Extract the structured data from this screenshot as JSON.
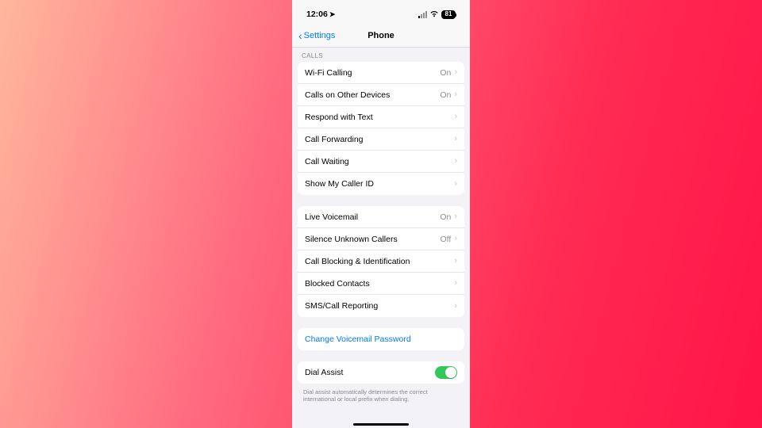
{
  "status": {
    "time": "12:06",
    "battery": "81"
  },
  "nav": {
    "back": "Settings",
    "title": "Phone"
  },
  "sections": {
    "calls_header": "CALLS"
  },
  "calls": [
    {
      "label": "Wi-Fi Calling",
      "value": "On"
    },
    {
      "label": "Calls on Other Devices",
      "value": "On"
    },
    {
      "label": "Respond with Text",
      "value": ""
    },
    {
      "label": "Call Forwarding",
      "value": ""
    },
    {
      "label": "Call Waiting",
      "value": ""
    },
    {
      "label": "Show My Caller ID",
      "value": ""
    }
  ],
  "group2": [
    {
      "label": "Live Voicemail",
      "value": "On"
    },
    {
      "label": "Silence Unknown Callers",
      "value": "Off"
    },
    {
      "label": "Call Blocking & Identification",
      "value": ""
    },
    {
      "label": "Blocked Contacts",
      "value": ""
    },
    {
      "label": "SMS/Call Reporting",
      "value": ""
    }
  ],
  "voicemail": {
    "change_pw": "Change Voicemail Password"
  },
  "dial_assist": {
    "label": "Dial Assist",
    "on": true,
    "footer": "Dial assist automatically determines the correct international or local prefix when dialing."
  }
}
